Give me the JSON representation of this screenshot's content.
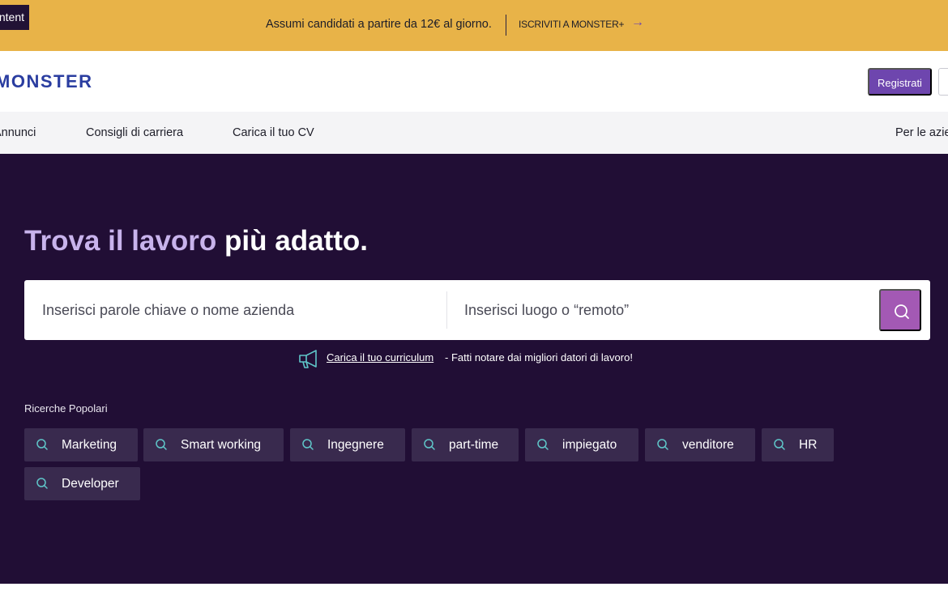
{
  "promo": {
    "skip_label": "Skip to content",
    "text": "Assumi candidati a partire da 12€ al giorno.",
    "link": "ISCRIVITI A MONSTER+",
    "arrow_icon": "arrow-right-icon"
  },
  "header": {
    "logo": "MONSTER",
    "register_label": "Registrati"
  },
  "nav": {
    "items": [
      {
        "label": "Annunci"
      },
      {
        "label": "Consigli di carriera"
      },
      {
        "label": "Carica il tuo CV"
      },
      {
        "label": "Per le aziende"
      }
    ]
  },
  "hero": {
    "title_part1": "Trova il lavoro",
    "title_part2": "più adatto.",
    "keyword_placeholder": "Inserisci parole chiave o nome azienda",
    "location_placeholder": "Inserisci luogo o “remoto”",
    "search_icon": "search-icon",
    "cv_link": "Carica il tuo curriculum",
    "cv_rest": " - Fatti notare dai migliori datori di lavoro!",
    "popular_label": "Ricerche Popolari",
    "popular": [
      {
        "label": "Marketing"
      },
      {
        "label": "Smart working"
      },
      {
        "label": "Ingegnere"
      },
      {
        "label": "part-time"
      },
      {
        "label": "impiegato"
      },
      {
        "label": "venditore"
      },
      {
        "label": "HR"
      },
      {
        "label": "Developer"
      }
    ]
  },
  "colors": {
    "promo_bg": "#e8b348",
    "hero_bg": "#210e35",
    "accent": "#6e46ae",
    "search_button": "#a359b4",
    "chip_bg": "#392a4e",
    "icon_teal": "#5fc6c9"
  }
}
